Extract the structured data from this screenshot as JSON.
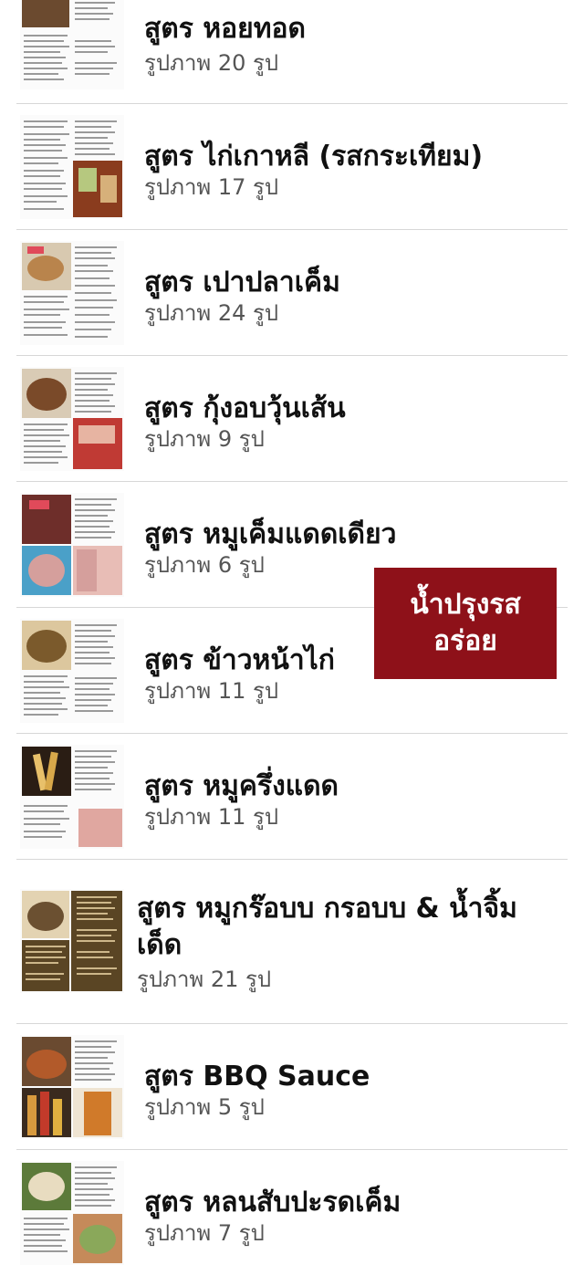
{
  "items": [
    {
      "title": "สูตร หอยทอด",
      "count": "รูปภาพ 20 รูป",
      "photo_a": "#6b4a2f",
      "photo_b": "#c9a77d"
    },
    {
      "title": "สูตร ไก่เกาหลี (รสกระเทียม)",
      "count": "รูปภาพ 17 รูป",
      "photo_a": "#8a3c1e",
      "photo_b": "#b6c87f"
    },
    {
      "title": "สูตร เปาปลาเค็ม",
      "count": "รูปภาพ 24 รูป",
      "photo_a": "#b9844c",
      "photo_b": "#d8c9b0"
    },
    {
      "title": "สูตร กุ้งอบวุ้นเส้น",
      "count": "รูปภาพ 9 รูป",
      "photo_a": "#7a4a29",
      "photo_b": "#c03a34"
    },
    {
      "title": "สูตร หมูเค็มแดดเดียว",
      "count": "รูปภาพ 6 รูป",
      "photo_a": "#6e2e2a",
      "photo_b": "#d59f9c"
    },
    {
      "title": "สูตร ข้าวหน้าไก่",
      "count": "รูปภาพ 11 รูป",
      "photo_a": "#7b5a2c",
      "photo_b": "#dcc79e"
    },
    {
      "title": "สูตร หมูครึ่งแดด",
      "count": "รูปภาพ 11 รูป",
      "photo_a": "#2a1d14",
      "photo_b": "#e0a7a0"
    },
    {
      "title": "สูตร หมูกร๊อบบ กรอบบ & น้ำจิ้มเด็ด",
      "count": "รูปภาพ 21 รูป",
      "photo_a": "#6b5031",
      "photo_b": "#5a4524"
    },
    {
      "title": "สูตร BBQ Sauce",
      "count": "รูปภาพ 5 รูป",
      "photo_a": "#b25a2a",
      "photo_b": "#d89a3e"
    },
    {
      "title": "สูตร หลนสับปะรดเค็ม",
      "count": "รูปภาพ 7 รูป",
      "photo_a": "#5c7a3a",
      "photo_b": "#c58a5a"
    }
  ],
  "overlay": {
    "line1": "น้ำปรุงรส",
    "line2": "อร่อย",
    "color": "#8e1119"
  }
}
